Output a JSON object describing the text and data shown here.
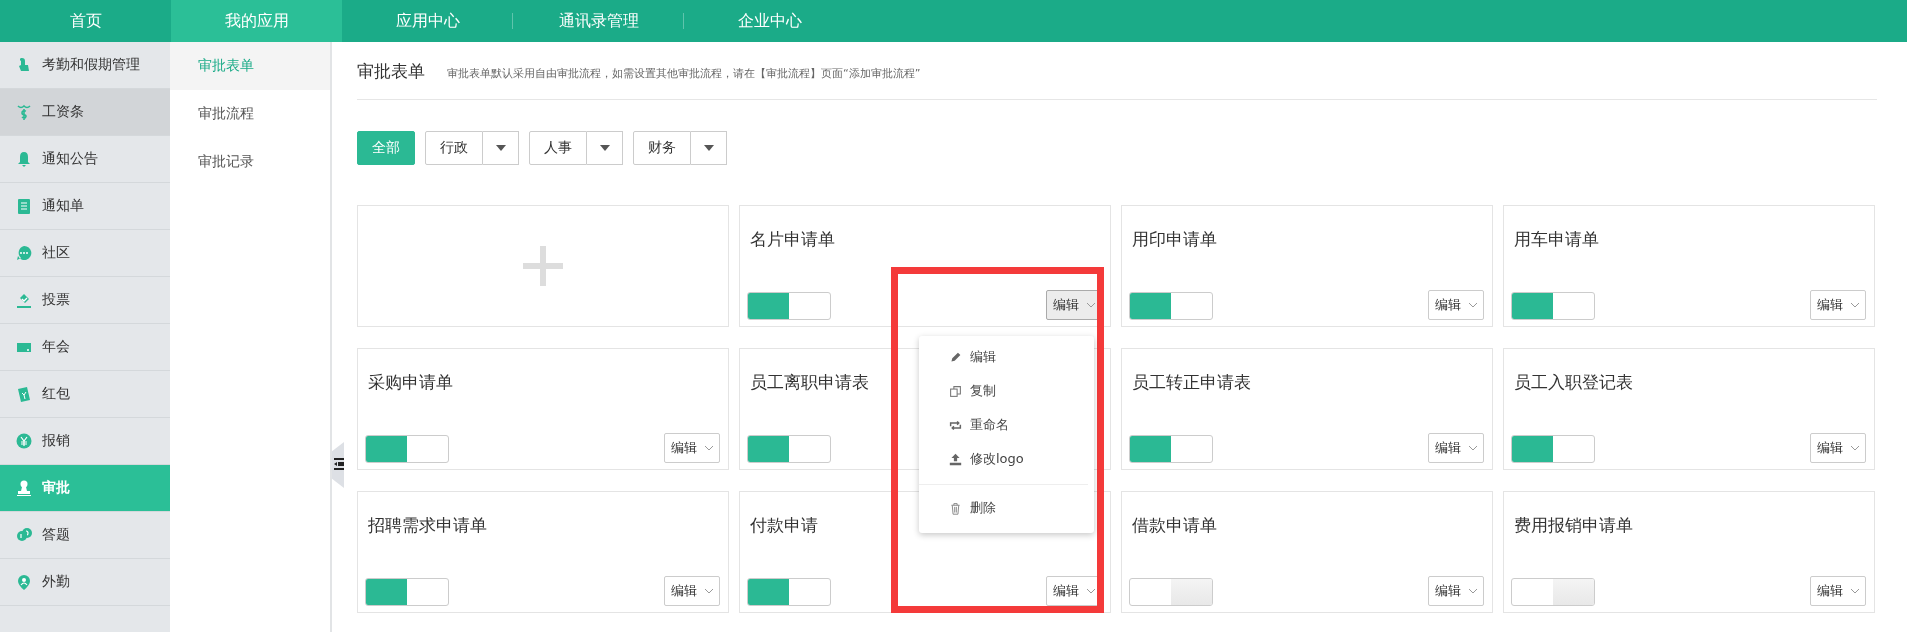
{
  "top_nav": [
    {
      "label": "首页",
      "selected": false
    },
    {
      "label": "我的应用",
      "selected": true
    },
    {
      "label": "应用中心",
      "selected": false
    },
    {
      "label": "通讯录管理",
      "selected": false
    },
    {
      "label": "企业中心",
      "selected": false
    }
  ],
  "sidebar": {
    "items": [
      {
        "label": "考勤和假期管理",
        "selected": false,
        "hovered": false
      },
      {
        "label": "工资条",
        "selected": false,
        "hovered": true
      },
      {
        "label": "通知公告",
        "selected": false,
        "hovered": false
      },
      {
        "label": "通知单",
        "selected": false,
        "hovered": false
      },
      {
        "label": "社区",
        "selected": false,
        "hovered": false
      },
      {
        "label": "投票",
        "selected": false,
        "hovered": false
      },
      {
        "label": "年会",
        "selected": false,
        "hovered": false
      },
      {
        "label": "红包",
        "selected": false,
        "hovered": false
      },
      {
        "label": "报销",
        "selected": false,
        "hovered": false
      },
      {
        "label": "审批",
        "selected": true,
        "hovered": false
      },
      {
        "label": "答题",
        "selected": false,
        "hovered": false
      },
      {
        "label": "外勤",
        "selected": false,
        "hovered": false
      }
    ]
  },
  "subnav": {
    "items": [
      {
        "label": "审批表单",
        "selected": true
      },
      {
        "label": "审批流程",
        "selected": false
      },
      {
        "label": "审批记录",
        "selected": false
      }
    ]
  },
  "header": {
    "title": "审批表单",
    "hint": "审批表单默认采用自由审批流程，如需设置其他审批流程，请在【审批流程】页面“添加审批流程”"
  },
  "filters": [
    {
      "label": "全部",
      "selected": true,
      "has_dropdown": false
    },
    {
      "label": "行政",
      "selected": false,
      "has_dropdown": true
    },
    {
      "label": "人事",
      "selected": false,
      "has_dropdown": true
    },
    {
      "label": "财务",
      "selected": false,
      "has_dropdown": true
    }
  ],
  "cards": [
    {
      "kind": "add"
    },
    {
      "kind": "form",
      "title": "名片申请单",
      "on": true,
      "edit_label": "编辑",
      "menu_open": true
    },
    {
      "kind": "form",
      "title": "用印申请单",
      "on": true,
      "edit_label": "编辑",
      "menu_open": false
    },
    {
      "kind": "form",
      "title": "用车申请单",
      "on": true,
      "edit_label": "编辑",
      "menu_open": false
    },
    {
      "kind": "form",
      "title": "采购申请单",
      "on": true,
      "edit_label": "编辑",
      "menu_open": false
    },
    {
      "kind": "form",
      "title": "员工离职申请表",
      "on": true
    },
    {
      "kind": "form",
      "title": "员工转正申请表",
      "on": true,
      "edit_label": "编辑",
      "menu_open": false
    },
    {
      "kind": "form",
      "title": "员工入职登记表",
      "on": true,
      "edit_label": "编辑",
      "menu_open": false
    },
    {
      "kind": "form",
      "title": "招聘需求申请单",
      "on": true,
      "edit_label": "编辑",
      "menu_open": false
    },
    {
      "kind": "form",
      "title": "付款申请",
      "on": true,
      "edit_label": "编辑",
      "menu_open": false
    },
    {
      "kind": "form",
      "title": "借款申请单",
      "on": false,
      "edit_label": "编辑",
      "menu_open": false
    },
    {
      "kind": "form",
      "title": "费用报销申请单",
      "on": false,
      "edit_label": "编辑",
      "menu_open": false
    }
  ],
  "edit_menu": [
    {
      "kind": "edit",
      "label": "编辑"
    },
    {
      "kind": "copy",
      "label": "复制"
    },
    {
      "kind": "rename",
      "label": "重命名"
    },
    {
      "kind": "upload",
      "label": "修改logo"
    },
    {
      "kind": "delete",
      "label": "删除"
    }
  ]
}
